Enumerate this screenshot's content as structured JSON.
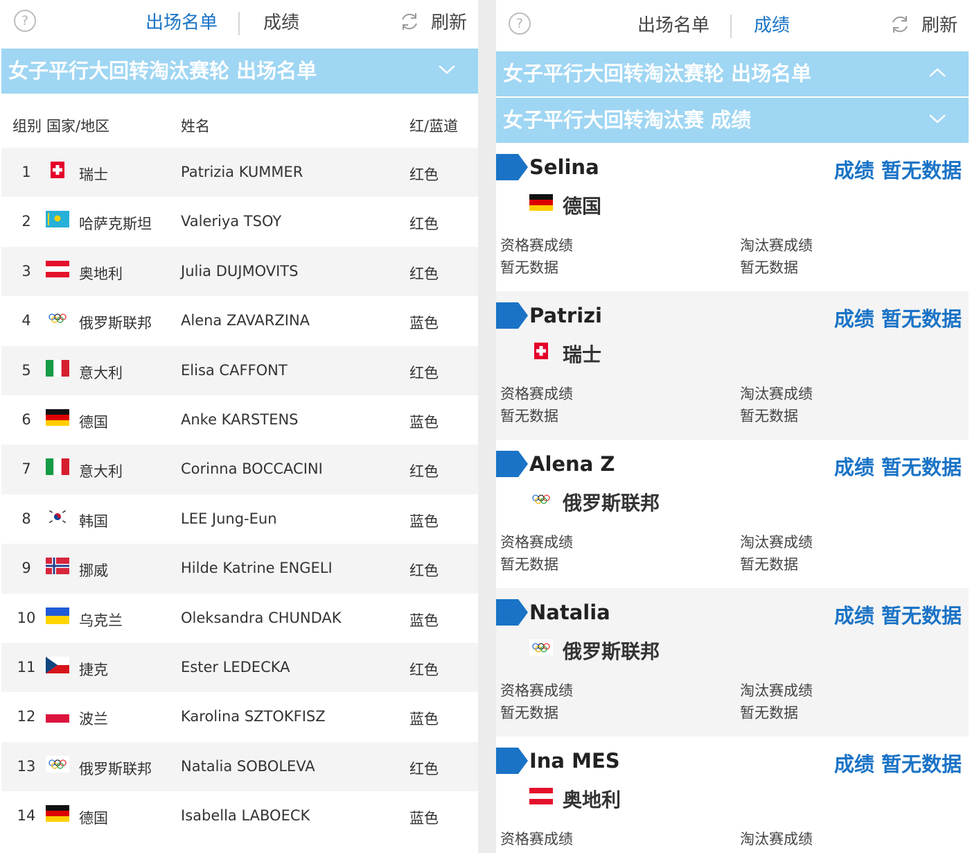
{
  "left": {
    "help": "?",
    "tab_roster": "出场名单",
    "tab_results": "成绩",
    "refresh": "刷新",
    "section_title": "女子平行大回转淘汰赛轮 出场名单",
    "columns": {
      "group": "组别",
      "country": "国家/地区",
      "name": "姓名",
      "lane": "红/蓝道"
    },
    "rows": [
      {
        "num": "1",
        "flag": "SUI",
        "country": "瑞士",
        "name": "Patrizia KUMMER",
        "lane": "红色"
      },
      {
        "num": "2",
        "flag": "KAZ",
        "country": "哈萨克斯坦",
        "name": "Valeriya TSOY",
        "lane": "红色"
      },
      {
        "num": "3",
        "flag": "AUT",
        "country": "奥地利",
        "name": "Julia DUJMOVITS",
        "lane": "红色"
      },
      {
        "num": "4",
        "flag": "OAR",
        "country": "俄罗斯联邦",
        "name": "Alena ZAVARZINA",
        "lane": "蓝色"
      },
      {
        "num": "5",
        "flag": "ITA",
        "country": "意大利",
        "name": "Elisa CAFFONT",
        "lane": "红色"
      },
      {
        "num": "6",
        "flag": "GER",
        "country": "德国",
        "name": "Anke KARSTENS",
        "lane": "蓝色"
      },
      {
        "num": "7",
        "flag": "ITA",
        "country": "意大利",
        "name": "Corinna BOCCACINI",
        "lane": "红色"
      },
      {
        "num": "8",
        "flag": "KOR",
        "country": "韩国",
        "name": "LEE Jung-Eun",
        "lane": "蓝色"
      },
      {
        "num": "9",
        "flag": "NOR",
        "country": "挪威",
        "name": "Hilde Katrine ENGELI",
        "lane": "红色"
      },
      {
        "num": "10",
        "flag": "UKR",
        "country": "乌克兰",
        "name": "Oleksandra CHUNDAK",
        "lane": "蓝色"
      },
      {
        "num": "11",
        "flag": "CZE",
        "country": "捷克",
        "name": "Ester LEDECKA",
        "lane": "红色"
      },
      {
        "num": "12",
        "flag": "POL",
        "country": "波兰",
        "name": "Karolina SZTOKFISZ",
        "lane": "蓝色"
      },
      {
        "num": "13",
        "flag": "OAR",
        "country": "俄罗斯联邦",
        "name": "Natalia SOBOLEVA",
        "lane": "红色"
      },
      {
        "num": "14",
        "flag": "GER",
        "country": "德国",
        "name": "Isabella LABOECK",
        "lane": "蓝色"
      }
    ]
  },
  "right": {
    "help": "?",
    "tab_roster": "出场名单",
    "tab_results": "成绩",
    "refresh": "刷新",
    "section_roster": "女子平行大回转淘汰赛轮 出场名单",
    "section_results": "女子平行大回转淘汰赛 成绩",
    "qual_label": "资格赛成绩",
    "elim_label": "淘汰赛成绩",
    "no_data": "暂无数据",
    "result_label": "成绩 暂无数据",
    "cards": [
      {
        "athlete": "Selina",
        "flag": "GER",
        "country": "德国"
      },
      {
        "athlete": "Patrizi",
        "flag": "SUI",
        "country": "瑞士"
      },
      {
        "athlete": "Alena Z",
        "flag": "OAR",
        "country": "俄罗斯联邦"
      },
      {
        "athlete": "Natalia",
        "flag": "OAR",
        "country": "俄罗斯联邦"
      },
      {
        "athlete": "Ina MES",
        "flag": "AUT",
        "country": "奥地利"
      }
    ]
  },
  "colors": {
    "accent": "#1a73c6",
    "section_bg": "#9fd6f3",
    "stripe": "#f4f4f4"
  }
}
